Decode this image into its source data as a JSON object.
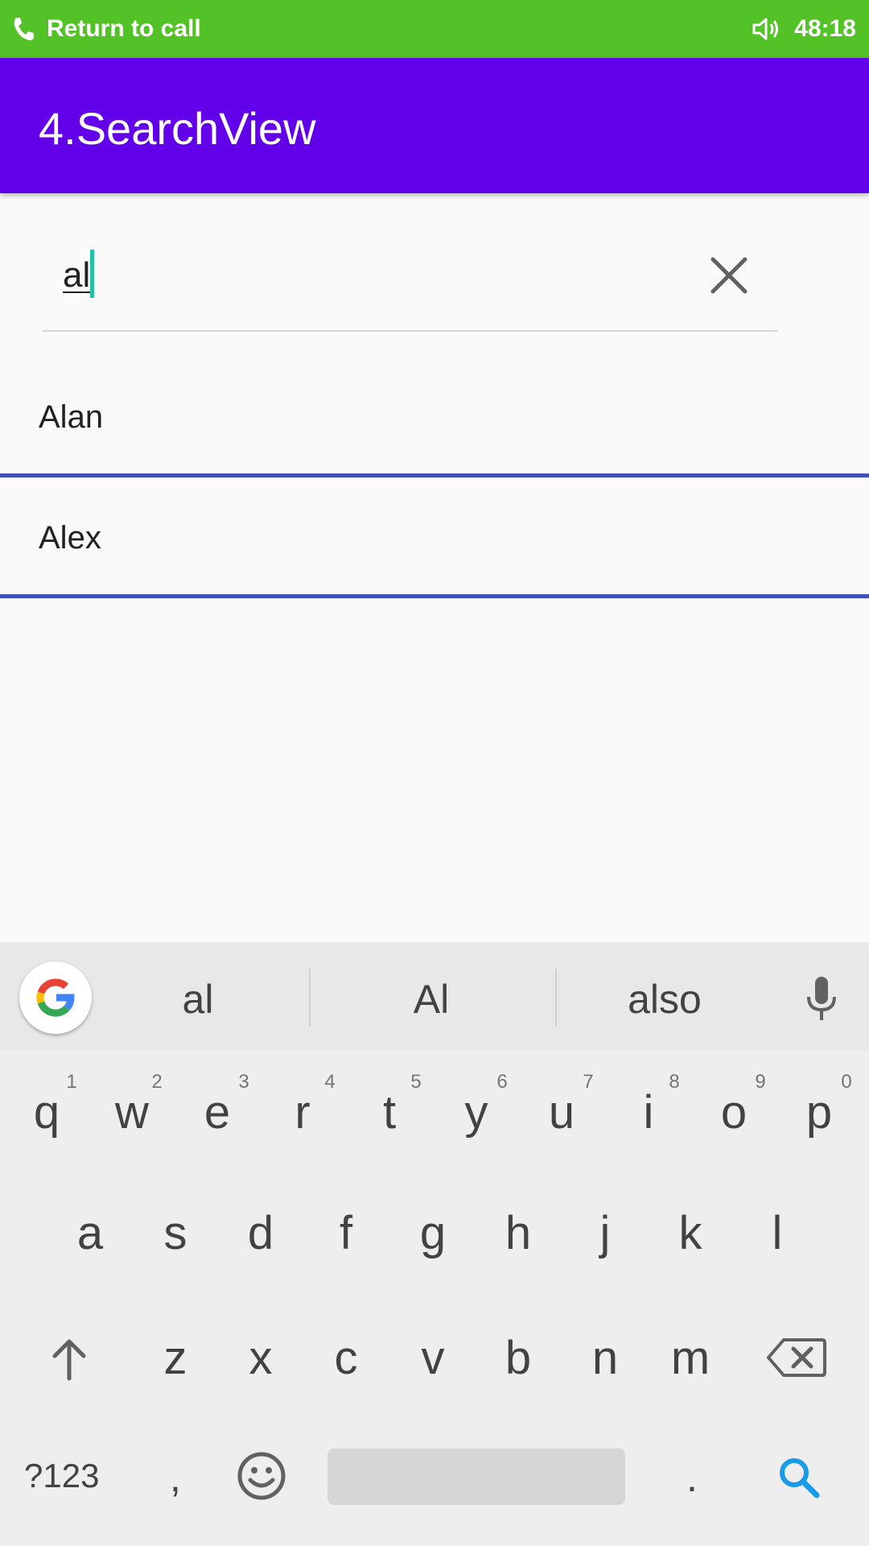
{
  "status_bar": {
    "call_text": "Return to call",
    "time": "48:18"
  },
  "app_bar": {
    "title": "4.SearchView"
  },
  "search": {
    "query": "al"
  },
  "results": [
    {
      "label": "Alan"
    },
    {
      "label": "Alex"
    }
  ],
  "keyboard": {
    "suggestions": [
      "al",
      "Al",
      "also"
    ],
    "row1": [
      "q",
      "w",
      "e",
      "r",
      "t",
      "y",
      "u",
      "i",
      "o",
      "p"
    ],
    "row1_hints": [
      "1",
      "2",
      "3",
      "4",
      "5",
      "6",
      "7",
      "8",
      "9",
      "0"
    ],
    "row2": [
      "a",
      "s",
      "d",
      "f",
      "g",
      "h",
      "j",
      "k",
      "l"
    ],
    "row3": [
      "z",
      "x",
      "c",
      "v",
      "b",
      "n",
      "m"
    ],
    "symbols_key": "?123",
    "comma_key": ",",
    "period_key": ".",
    "accent_color": "#1a9be8"
  }
}
